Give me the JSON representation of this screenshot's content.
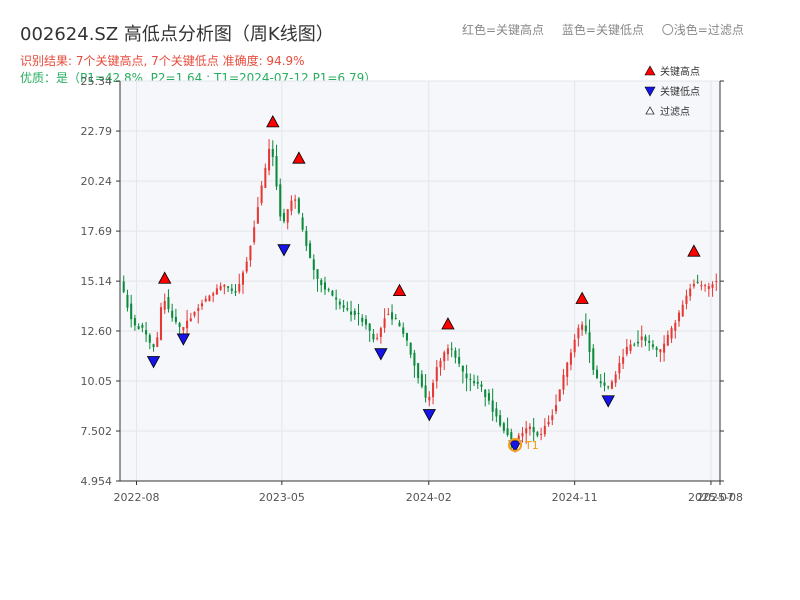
{
  "header": {
    "title": "002624.SZ 高低点分析图（周K线图）",
    "result_line": "识别结果: 7个关键高点, 7个关键低点  准确度: 94.9%",
    "quality_line": "优质：是（P1=42.8%, P2=1.64 ; T1=2024-07-12 P1=6.79）"
  },
  "top_legend": {
    "red": "红色=关键高点",
    "blue": "蓝色=关键低点",
    "light": "〇浅色=过滤点"
  },
  "colors": {
    "up": "#e53935",
    "down": "#0a8a3a",
    "high_marker": "#ff0000",
    "low_marker": "#1515e8",
    "t1_marker": "#f39c12",
    "plot_bg": "#f5f7fa",
    "grid": "#e3e6ea"
  },
  "chart_data": {
    "type": "candlestick",
    "x_range": [
      "2022-07-01",
      "2025-08-01"
    ],
    "ylim": [
      4.954,
      25.34
    ],
    "y_ticks": [
      "4.954",
      "7.502",
      "10.05",
      "12.60",
      "15.14",
      "17.69",
      "20.24",
      "22.79",
      "25.34"
    ],
    "x_ticks": [
      {
        "date": "2022-08-01",
        "label": "2022-08"
      },
      {
        "date": "2023-05-01",
        "label": "2023-05"
      },
      {
        "date": "2024-02-01",
        "label": "2024-02"
      },
      {
        "date": "2024-11-01",
        "label": "2024-11"
      },
      {
        "date": "2025-07-15",
        "label": "2025-07"
      },
      {
        "date": "2025-08-01",
        "label": "2025-08"
      }
    ],
    "price_anchors": [
      [
        "2022-07-01",
        15.4
      ],
      [
        "2022-07-29",
        13.0
      ],
      [
        "2022-08-19",
        12.6
      ],
      [
        "2022-09-09",
        11.5
      ],
      [
        "2022-09-23",
        14.5
      ],
      [
        "2022-10-07",
        13.4
      ],
      [
        "2022-10-28",
        12.6
      ],
      [
        "2022-11-18",
        13.5
      ],
      [
        "2022-12-16",
        14.3
      ],
      [
        "2023-01-13",
        15.0
      ],
      [
        "2023-02-10",
        14.6
      ],
      [
        "2023-03-03",
        16.5
      ],
      [
        "2023-03-24",
        19.5
      ],
      [
        "2023-04-14",
        22.3
      ],
      [
        "2023-05-05",
        17.8
      ],
      [
        "2023-05-26",
        19.6
      ],
      [
        "2023-06-16",
        17.4
      ],
      [
        "2023-07-07",
        15.3
      ],
      [
        "2023-07-28",
        14.7
      ],
      [
        "2023-08-25",
        13.8
      ],
      [
        "2023-09-29",
        13.3
      ],
      [
        "2023-10-27",
        12.1
      ],
      [
        "2023-11-17",
        13.6
      ],
      [
        "2023-12-08",
        13.0
      ],
      [
        "2023-12-29",
        11.8
      ],
      [
        "2024-01-19",
        10.0
      ],
      [
        "2024-02-02",
        8.9
      ],
      [
        "2024-02-23",
        11.0
      ],
      [
        "2024-03-15",
        11.9
      ],
      [
        "2024-04-12",
        10.2
      ],
      [
        "2024-05-10",
        9.9
      ],
      [
        "2024-06-14",
        8.0
      ],
      [
        "2024-07-12",
        7.0
      ],
      [
        "2024-08-09",
        7.7
      ],
      [
        "2024-08-30",
        7.2
      ],
      [
        "2024-09-27",
        8.6
      ],
      [
        "2024-10-18",
        10.6
      ],
      [
        "2024-11-08",
        12.6
      ],
      [
        "2024-11-22",
        13.0
      ],
      [
        "2024-12-13",
        10.2
      ],
      [
        "2025-01-10",
        9.7
      ],
      [
        "2025-02-07",
        11.6
      ],
      [
        "2025-03-14",
        12.3
      ],
      [
        "2025-04-11",
        11.4
      ],
      [
        "2025-05-16",
        13.2
      ],
      [
        "2025-06-13",
        15.1
      ],
      [
        "2025-07-11",
        14.8
      ],
      [
        "2025-08-01",
        15.2
      ]
    ],
    "key_highs": [
      {
        "date": "2022-09-23",
        "value": 14.93
      },
      {
        "date": "2023-04-14",
        "value": 22.9
      },
      {
        "date": "2023-06-02",
        "value": 21.05
      },
      {
        "date": "2023-12-08",
        "value": 14.3
      },
      {
        "date": "2024-03-08",
        "value": 12.6
      },
      {
        "date": "2024-11-15",
        "value": 13.9
      },
      {
        "date": "2025-06-13",
        "value": 16.31
      }
    ],
    "key_lows": [
      {
        "date": "2022-09-02",
        "value": 11.4
      },
      {
        "date": "2022-10-28",
        "value": 12.55
      },
      {
        "date": "2023-05-05",
        "value": 17.1
      },
      {
        "date": "2023-11-03",
        "value": 11.8
      },
      {
        "date": "2024-02-02",
        "value": 8.7
      },
      {
        "date": "2024-07-12",
        "value": 7.1
      },
      {
        "date": "2025-01-03",
        "value": 9.4
      }
    ],
    "t1": {
      "date": "2024-07-12",
      "value": 6.79,
      "label": "T1"
    },
    "legend": {
      "high": "关键高点",
      "low": "关键低点",
      "filtered": "过滤点"
    }
  }
}
